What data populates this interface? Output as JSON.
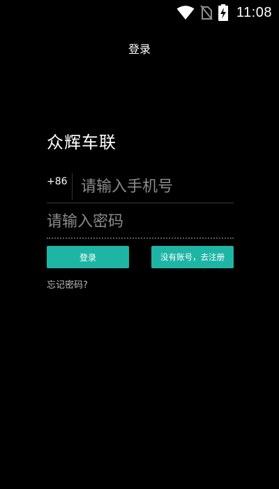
{
  "status_bar": {
    "time": "11:08",
    "icons": [
      "wifi-icon",
      "no-sim-icon",
      "battery-charging-icon"
    ]
  },
  "header": {
    "title": "登录"
  },
  "brand": {
    "name": "众辉车联"
  },
  "form": {
    "country_code": "+86",
    "phone_placeholder": "请输入手机号",
    "phone_value": "",
    "password_placeholder": "请输入密码",
    "password_value": "",
    "login_label": "登录",
    "register_label": "没有账号，去注册",
    "forgot_label": "忘记密码?"
  },
  "colors": {
    "background": "#000000",
    "accent": "#1fb5a5",
    "text": "#ffffff",
    "placeholder": "#8a8a8a"
  }
}
